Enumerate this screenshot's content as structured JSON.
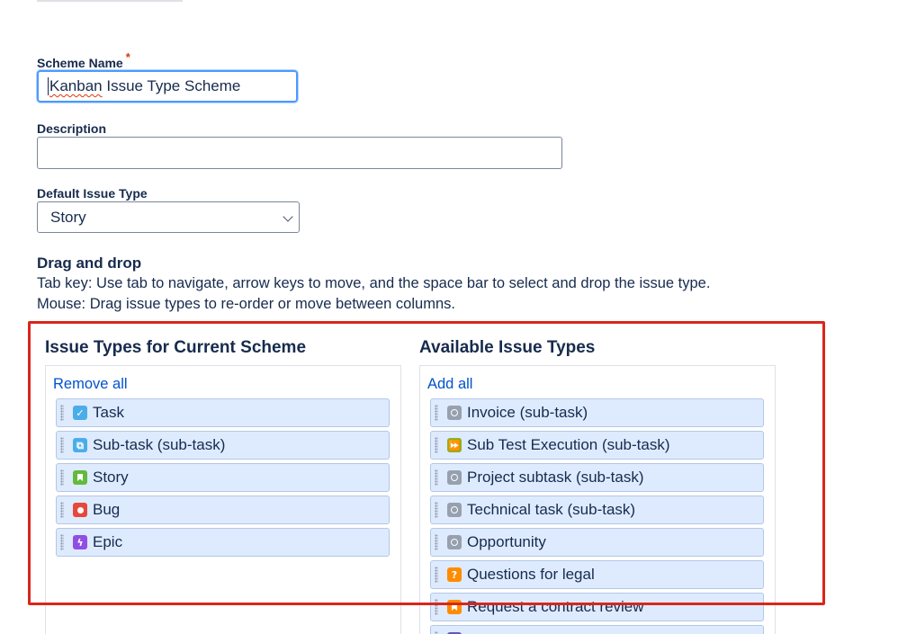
{
  "form": {
    "scheme_name_label": "Scheme Name",
    "required_marker": "*",
    "scheme_name_value_underlined": "Kanban",
    "scheme_name_value_rest": " Issue Type Scheme",
    "description_label": "Description",
    "description_value": "",
    "default_issue_type_label": "Default Issue Type",
    "default_issue_type_value": "Story"
  },
  "dnd": {
    "title": "Drag and drop",
    "line1": "Tab key: Use tab to navigate, arrow keys to move, and the space bar to select and drop the issue type.",
    "line2": "Mouse: Drag issue types to re-order or move between columns."
  },
  "current": {
    "title": "Issue Types for Current Scheme",
    "action": "Remove all",
    "items": [
      {
        "label": "Task",
        "icon": "task-icon",
        "color": "#4bade8",
        "glyph": "✓",
        "shape": "text"
      },
      {
        "label": "Sub-task (sub-task)",
        "icon": "subtask-icon",
        "color": "#4bade8",
        "glyph": "⧉",
        "shape": "text"
      },
      {
        "label": "Story",
        "icon": "story-icon",
        "color": "#63ba3c",
        "glyph": "",
        "shape": "book"
      },
      {
        "label": "Bug",
        "icon": "bug-icon",
        "color": "#e5493a",
        "glyph": "",
        "shape": "dot"
      },
      {
        "label": "Epic",
        "icon": "epic-icon",
        "color": "#904ee2",
        "glyph": "ϟ",
        "shape": "text"
      }
    ]
  },
  "available": {
    "title": "Available Issue Types",
    "action": "Add all",
    "items": [
      {
        "label": "Invoice (sub-task)",
        "icon": "generic-subtask-icon",
        "color": "#97a0af",
        "glyph": "",
        "shape": "ring"
      },
      {
        "label": "Sub Test Execution (sub-task)",
        "icon": "test-execution-icon",
        "color": "#8fb021",
        "glyph": "⏩",
        "shape": "text"
      },
      {
        "label": "Project subtask (sub-task)",
        "icon": "generic-subtask-icon",
        "color": "#97a0af",
        "glyph": "",
        "shape": "ring"
      },
      {
        "label": "Technical task (sub-task)",
        "icon": "generic-subtask-icon",
        "color": "#97a0af",
        "glyph": "",
        "shape": "ring"
      },
      {
        "label": "Opportunity",
        "icon": "generic-issue-icon",
        "color": "#97a0af",
        "glyph": "",
        "shape": "ring"
      },
      {
        "label": "Questions for legal",
        "icon": "question-icon",
        "color": "#ff8b00",
        "glyph": "?",
        "shape": "text"
      },
      {
        "label": "Request a contract review",
        "icon": "contract-review-icon",
        "color": "#ff8b00",
        "glyph": "",
        "shape": "book"
      },
      {
        "label": "",
        "icon": "purple-issue-icon",
        "color": "#6554c0",
        "glyph": "",
        "shape": "text"
      }
    ]
  },
  "highlight": {
    "color": "#d9261c"
  }
}
